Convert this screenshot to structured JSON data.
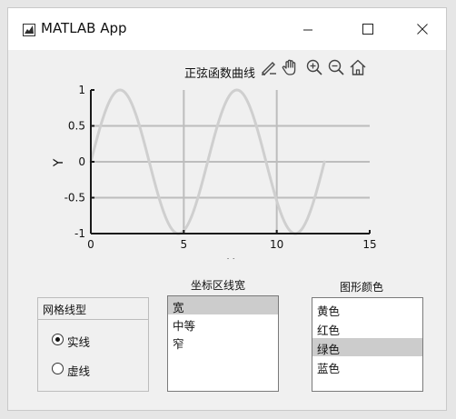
{
  "window": {
    "title": "MATLAB App",
    "minimize_icon": "minimize-icon",
    "maximize_icon": "maximize-icon",
    "close_icon": "close-icon"
  },
  "axes_toolbar": {
    "icons": [
      "brush-icon",
      "pan-hand-icon",
      "zoom-in-icon",
      "zoom-out-icon",
      "home-icon"
    ]
  },
  "chart_data": {
    "type": "line",
    "title": "正弦函数曲线",
    "xlabel": "X",
    "ylabel": "Y",
    "xlim": [
      0,
      15
    ],
    "ylim": [
      -1,
      1
    ],
    "xticks": [
      0,
      5,
      10,
      15
    ],
    "xtick_labels": [
      "0",
      "5",
      "10",
      "15"
    ],
    "yticks": [
      -1,
      -0.5,
      0,
      0.5,
      1
    ],
    "ytick_labels": [
      "-1",
      "-0.5",
      "0",
      "0.5",
      "1"
    ],
    "grid": true,
    "grid_color": "#bdbdbd",
    "series": [
      {
        "function": "sin(x)",
        "x_range": [
          0,
          12.566
        ],
        "color": "#cfcfcf"
      }
    ]
  },
  "line_width_list": {
    "label": "坐标区线宽",
    "items": [
      "宽",
      "中等",
      "窄"
    ],
    "selected_index": 0
  },
  "grid_style_panel": {
    "title": "网格线型",
    "options": [
      "实线",
      "虚线"
    ],
    "selected_index": 0
  },
  "color_list": {
    "label": "图形颜色",
    "items": [
      "黄色",
      "红色",
      "绿色",
      "蓝色"
    ],
    "selected_index": 2
  },
  "colors": {
    "selection": "#cccccc",
    "background": "#f0f0f0",
    "plot_line": "#cfcfcf",
    "axes": "#1a1a1a"
  }
}
